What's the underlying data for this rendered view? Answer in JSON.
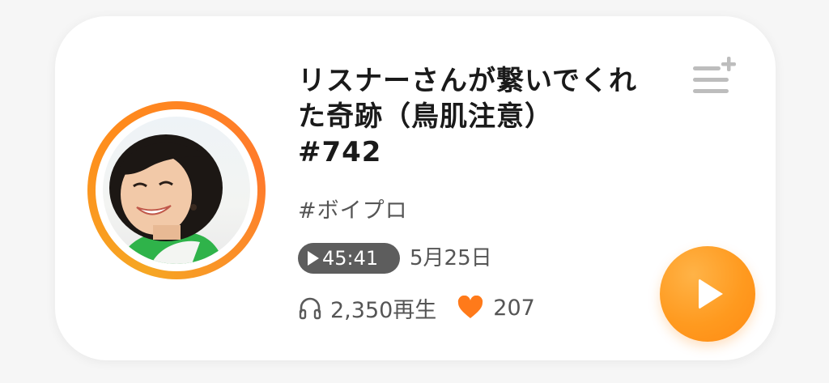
{
  "episode": {
    "title": "リスナーさんが繋いでくれ\nた奇跡（鳥肌注意）\n#742",
    "tag": "#ボイプロ",
    "duration": "45:41",
    "date": "5月25日",
    "plays": "2,350再生",
    "likes": "207"
  },
  "icons": {
    "playlist_add": "playlist-add-icon",
    "play": "play-icon",
    "headphones": "headphones-icon",
    "heart": "heart-icon"
  },
  "colors": {
    "accent": "#ff8a12",
    "heart": "#ff7a1a",
    "duration_bg": "#5d5d5d"
  }
}
